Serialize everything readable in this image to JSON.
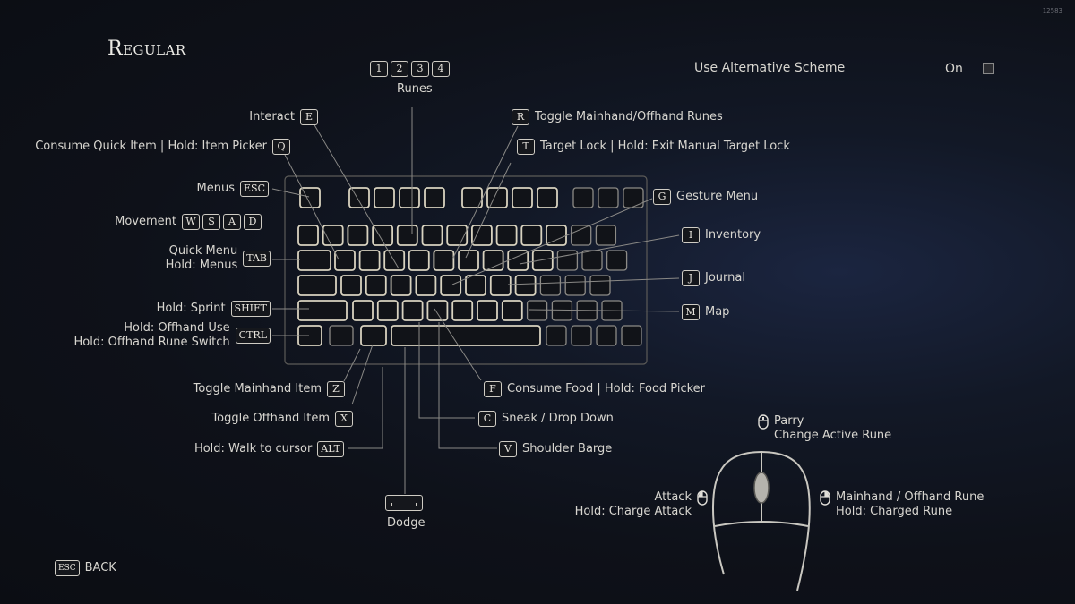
{
  "page": {
    "title": "Regular",
    "version": "12583"
  },
  "alternative_scheme": {
    "label": "Use Alternative Scheme",
    "value": "On",
    "checked": false
  },
  "runes": {
    "keys": [
      "1",
      "2",
      "3",
      "4"
    ],
    "label": "Runes"
  },
  "left_bindings": [
    {
      "id": "interact",
      "label": "Interact",
      "keys": [
        "E"
      ]
    },
    {
      "id": "consume-quick-item",
      "label": "Consume Quick Item | Hold: Item Picker",
      "keys": [
        "Q"
      ]
    },
    {
      "id": "menus",
      "label": "Menus",
      "keys": [
        "ESC"
      ]
    },
    {
      "id": "movement",
      "label": "Movement",
      "keys": [
        "W",
        "S",
        "A",
        "D"
      ]
    },
    {
      "id": "quick-menu",
      "label_lines": [
        "Quick Menu",
        "Hold: Menus"
      ],
      "keys": [
        "TAB"
      ]
    },
    {
      "id": "sprint",
      "label": "Hold: Sprint",
      "keys": [
        "SHIFT"
      ]
    },
    {
      "id": "offhand-use",
      "label_lines": [
        "Hold: Offhand Use",
        "Hold: Offhand Rune Switch"
      ],
      "keys": [
        "CTRL"
      ]
    },
    {
      "id": "toggle-mainhand-item",
      "label": "Toggle Mainhand Item",
      "keys": [
        "Z"
      ]
    },
    {
      "id": "toggle-offhand-item",
      "label": "Toggle Offhand Item",
      "keys": [
        "X"
      ]
    },
    {
      "id": "walk-to-cursor",
      "label": "Hold: Walk to cursor",
      "keys": [
        "ALT"
      ]
    }
  ],
  "right_bindings": [
    {
      "id": "toggle-runes",
      "label": "Toggle Mainhand/Offhand Runes",
      "keys": [
        "R"
      ]
    },
    {
      "id": "target-lock",
      "label": "Target Lock | Hold: Exit Manual Target Lock",
      "keys": [
        "T"
      ]
    },
    {
      "id": "gesture-menu",
      "label": "Gesture Menu",
      "keys": [
        "G"
      ]
    },
    {
      "id": "inventory",
      "label": "Inventory",
      "keys": [
        "I"
      ]
    },
    {
      "id": "journal",
      "label": "Journal",
      "keys": [
        "J"
      ]
    },
    {
      "id": "map",
      "label": "Map",
      "keys": [
        "M"
      ]
    },
    {
      "id": "consume-food",
      "label": "Consume Food | Hold: Food Picker",
      "keys": [
        "F"
      ]
    },
    {
      "id": "sneak",
      "label": "Sneak / Drop Down",
      "keys": [
        "C"
      ]
    },
    {
      "id": "shoulder-barge",
      "label": "Shoulder Barge",
      "keys": [
        "V"
      ]
    }
  ],
  "dodge": {
    "label": "Dodge",
    "key": "space-bar"
  },
  "mouse": {
    "middle": {
      "lines": [
        "Parry",
        "Change Active Rune"
      ],
      "icon": "mouse-middle-icon"
    },
    "left": {
      "lines": [
        "Attack",
        "Hold: Charge Attack"
      ],
      "icon": "mouse-left-icon"
    },
    "right": {
      "lines": [
        "Mainhand / Offhand Rune",
        "Hold: Charged Rune"
      ],
      "icon": "mouse-right-icon"
    }
  },
  "footer": {
    "back_key": "ESC",
    "back_label": "BACK"
  }
}
